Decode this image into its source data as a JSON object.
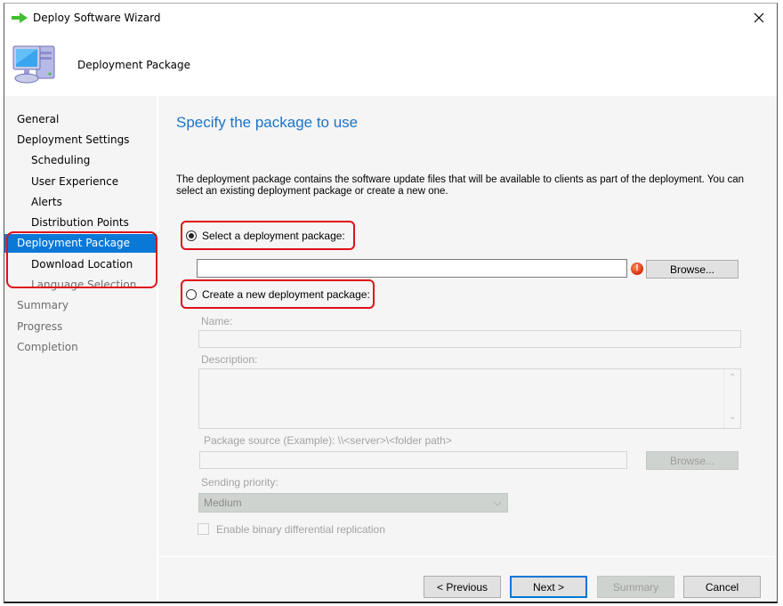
{
  "window": {
    "title": "Deploy Software Wizard",
    "close_label": "×",
    "banner_title": "Deployment Package"
  },
  "nav": {
    "items": [
      {
        "label": "General",
        "level": 0,
        "state": "normal"
      },
      {
        "label": "Deployment Settings",
        "level": 0,
        "state": "normal"
      },
      {
        "label": "Scheduling",
        "level": 1,
        "state": "normal"
      },
      {
        "label": "User Experience",
        "level": 1,
        "state": "normal"
      },
      {
        "label": "Alerts",
        "level": 1,
        "state": "normal"
      },
      {
        "label": "Distribution Points",
        "level": 1,
        "state": "normal"
      },
      {
        "label": "Deployment Package",
        "level": 0,
        "state": "active"
      },
      {
        "label": "Download Location",
        "level": 1,
        "state": "normal"
      },
      {
        "label": "Language Selection",
        "level": 1,
        "state": "disabled"
      },
      {
        "label": "Summary",
        "level": 0,
        "state": "disabled"
      },
      {
        "label": "Progress",
        "level": 0,
        "state": "disabled"
      },
      {
        "label": "Completion",
        "level": 0,
        "state": "disabled"
      }
    ]
  },
  "content": {
    "page_title": "Specify the package to use",
    "description": "The deployment package contains the software update files that will be available to clients as part of the deployment. You can select an existing deployment package or create a new one.",
    "select_existing": {
      "label": "Select a deployment package:",
      "checked": true,
      "value": "",
      "browse_label": "Browse...",
      "error_icon": "!"
    },
    "create_new": {
      "label": "Create a new deployment package:",
      "checked": false,
      "name_label": "Name:",
      "name_value": "",
      "description_label": "Description:",
      "description_value": "",
      "source_label": "Package source (Example): \\\\<server>\\<folder path>",
      "source_value": "",
      "browse_label": "Browse...",
      "priority_label": "Sending priority:",
      "priority_value": "Medium",
      "binary_replication_label": "Enable binary differential replication",
      "binary_replication_checked": false
    }
  },
  "footer": {
    "previous_label": "< Previous",
    "next_label": "Next >",
    "summary_label": "Summary",
    "cancel_label": "Cancel"
  },
  "colors": {
    "accent": "#0a78d7",
    "title_blue": "#1b74c8",
    "highlight_red": "#e0101a",
    "error_orange": "#d4320a"
  }
}
